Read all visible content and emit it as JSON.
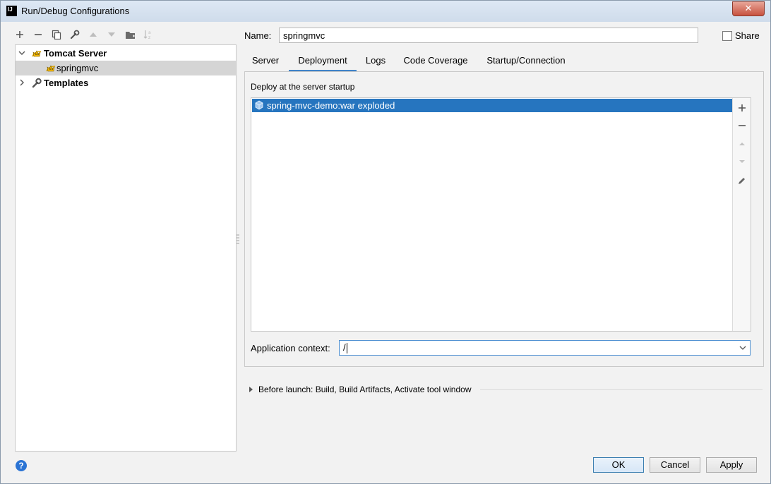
{
  "window": {
    "title": "Run/Debug Configurations",
    "app_icon_text": "IJ"
  },
  "toolbar": {
    "buttons": [
      {
        "icon": "add-icon",
        "glyph": "+"
      },
      {
        "icon": "remove-icon",
        "glyph": "−"
      },
      {
        "icon": "copy-icon",
        "glyph": "⧉"
      },
      {
        "icon": "wrench-icon",
        "glyph": "🔧"
      },
      {
        "icon": "move-up-icon",
        "glyph": "▲"
      },
      {
        "icon": "move-down-icon",
        "glyph": "▼"
      },
      {
        "icon": "folder-icon",
        "glyph": "📁"
      },
      {
        "icon": "sort-icon",
        "glyph": "⇅"
      }
    ]
  },
  "tree": {
    "items": [
      {
        "label": "Tomcat Server",
        "icon": "tomcat-icon"
      },
      {
        "label": "springmvc",
        "icon": "tomcat-icon"
      },
      {
        "label": "Templates",
        "icon": "wrench-icon"
      }
    ]
  },
  "config": {
    "name_label": "Name:",
    "name_value": "springmvc",
    "share_label": "Share"
  },
  "tabs": [
    {
      "label": "Server"
    },
    {
      "label": "Deployment"
    },
    {
      "label": "Logs"
    },
    {
      "label": "Code Coverage"
    },
    {
      "label": "Startup/Connection"
    }
  ],
  "deployment": {
    "section_label": "Deploy at the server startup",
    "artifacts": [
      "spring-mvc-demo:war exploded"
    ],
    "side_buttons": [
      "add-icon",
      "remove-icon",
      "move-up-icon",
      "move-down-icon",
      "edit-icon"
    ],
    "context_label": "Application context:",
    "context_value": "/"
  },
  "before_launch": {
    "text": "Before launch: Build, Build Artifacts, Activate tool window"
  },
  "buttons": {
    "ok": "OK",
    "cancel": "Cancel",
    "apply": "Apply",
    "help": "?"
  },
  "colors": {
    "selection": "#2675bf",
    "tab_underline": "#4083c9",
    "focus_border": "#4d8fd1",
    "help": "#2b74d4"
  }
}
